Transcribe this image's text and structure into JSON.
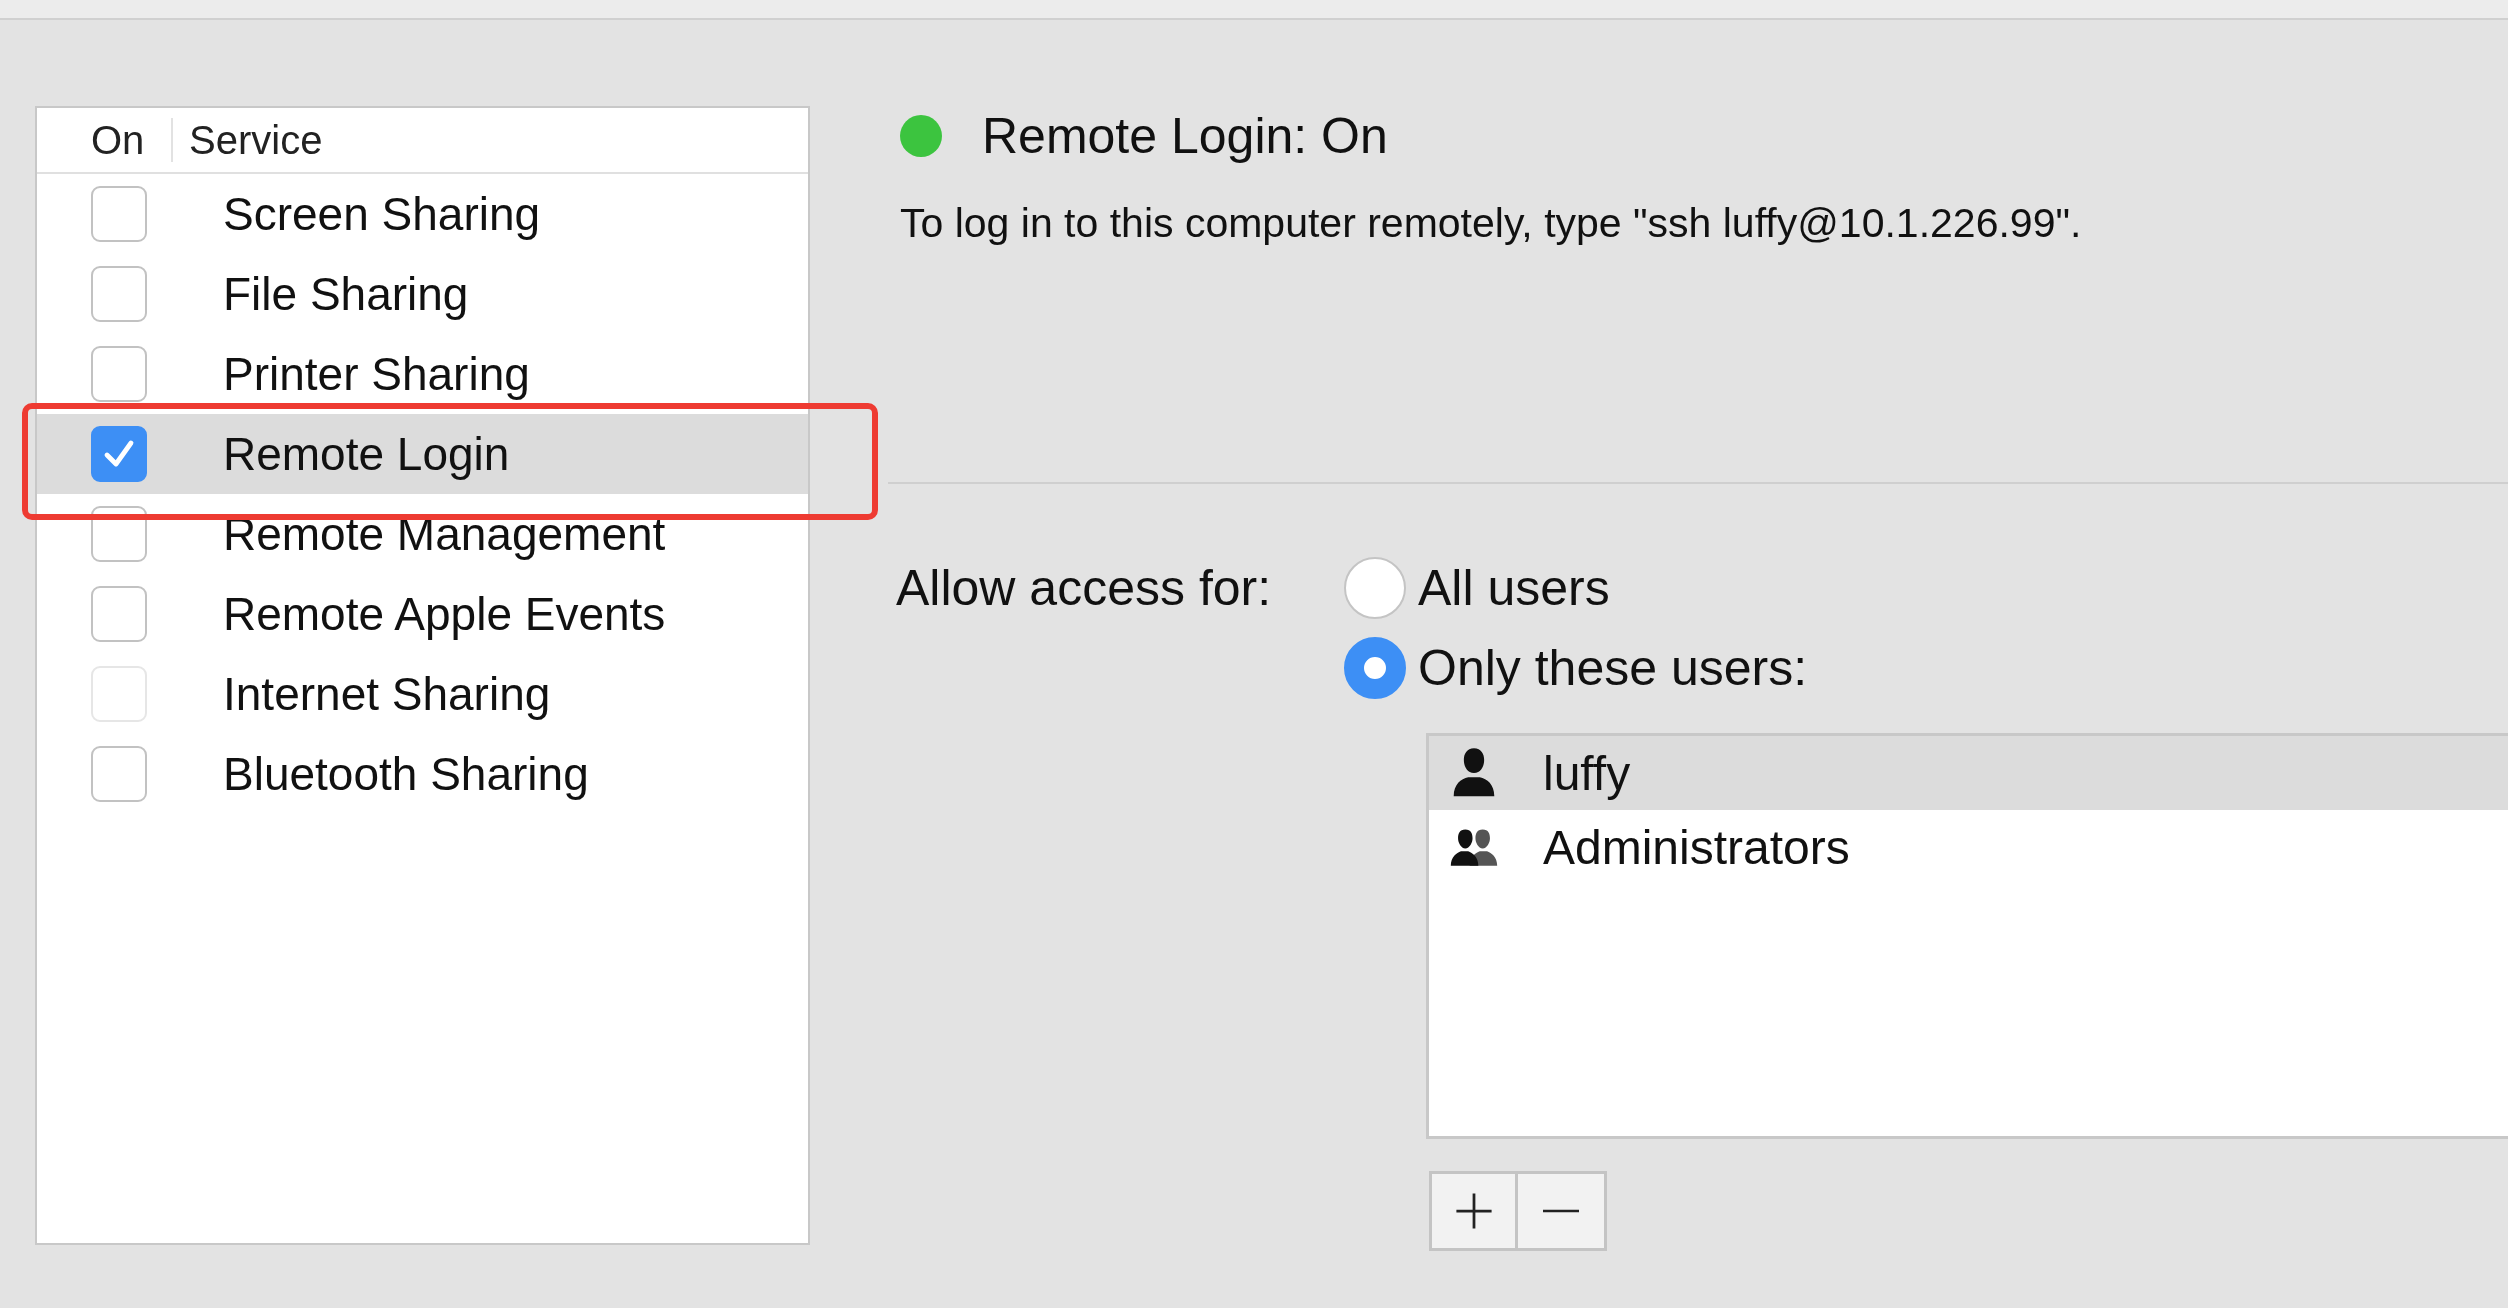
{
  "services": {
    "columns": [
      "On",
      "Service"
    ],
    "items": [
      {
        "name": "Screen Sharing",
        "checked": false,
        "selected": false,
        "disabled": false
      },
      {
        "name": "File Sharing",
        "checked": false,
        "selected": false,
        "disabled": false
      },
      {
        "name": "Printer Sharing",
        "checked": false,
        "selected": false,
        "disabled": false
      },
      {
        "name": "Remote Login",
        "checked": true,
        "selected": true,
        "disabled": false
      },
      {
        "name": "Remote Management",
        "checked": false,
        "selected": false,
        "disabled": false
      },
      {
        "name": "Remote Apple Events",
        "checked": false,
        "selected": false,
        "disabled": false
      },
      {
        "name": "Internet Sharing",
        "checked": false,
        "selected": false,
        "disabled": true
      },
      {
        "name": "Bluetooth Sharing",
        "checked": false,
        "selected": false,
        "disabled": false
      }
    ]
  },
  "highlight": {
    "on": true,
    "color": "#ee3b32"
  },
  "status": {
    "title": "Remote Login: On",
    "color": "#3cc43f",
    "description": "To log in to this computer remotely, type \"ssh luffy@10.1.226.99\"."
  },
  "access": {
    "label": "Allow access for:",
    "options": [
      {
        "label": "All users",
        "selected": false
      },
      {
        "label": "Only these users:",
        "selected": true
      }
    ]
  },
  "users": [
    {
      "name": "luffy",
      "kind": "user",
      "selected": true
    },
    {
      "name": "Administrators",
      "kind": "group",
      "selected": false
    }
  ]
}
